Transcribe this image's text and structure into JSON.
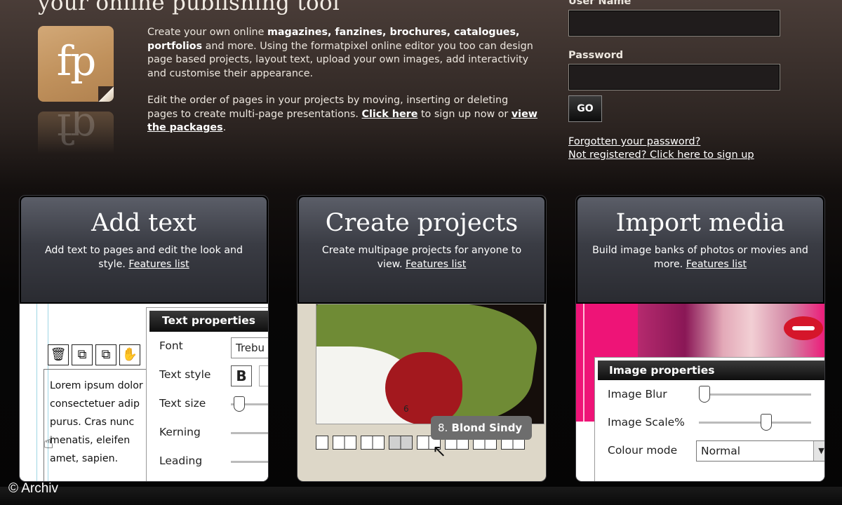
{
  "header": {
    "tagline": "your online publishing tool",
    "logo_text": "fp",
    "intro_p1_a": "Create your own online ",
    "intro_p1_bold": "magazines, fanzines, brochures, catalogues, portfolios",
    "intro_p1_b": " and more. Using the formatpixel online editor you too can design page based projects, layout text, upload your own images, add interactivity and customise their appearance.",
    "intro_p2_a": "Edit the order of pages in your projects by moving, inserting or deleting pages to create multi-page presentations. ",
    "intro_p2_link1": "Click here",
    "intro_p2_b": " to sign up now or ",
    "intro_p2_link2": "view the packages",
    "intro_p2_c": "."
  },
  "login": {
    "username_label": "User Name",
    "username_value": "",
    "password_label": "Password",
    "password_value": "",
    "go_label": "GO",
    "forgot_link": "Forgotten your password?",
    "signup_link": "Not registered? Click here to sign up"
  },
  "panels": [
    {
      "title": "Add text",
      "desc": "Add text to pages and edit the look and style.",
      "link": "Features list"
    },
    {
      "title": "Create projects",
      "desc": "Create multipage projects for anyone to view.",
      "link": "Features list"
    },
    {
      "title": "Import media",
      "desc": "Build image banks of photos or movies and more.",
      "link": "Features list"
    }
  ],
  "text_editor": {
    "card_title": "Text properties",
    "font_label": "Font",
    "font_value": "Trebu",
    "style_label": "Text style",
    "bold_label": "B",
    "size_label": "Text size",
    "kerning_label": "Kerning",
    "leading_label": "Leading",
    "lorem_lines": [
      "Lorem ipsum dolor",
      "consectetuer adip",
      "purus. Cras nunc",
      "menatis, eleifen",
      "amet, sapien."
    ],
    "text_size_level": 0.15
  },
  "projects_editor": {
    "page_number": "6",
    "tooltip_number": "8.",
    "tooltip_name": "Blond Sindy"
  },
  "media_editor": {
    "card_title": "Image properties",
    "blur_label": "Image Blur",
    "blur_level": 0.0,
    "scale_label": "Image Scale%",
    "scale_level": 0.6,
    "colour_label": "Colour mode",
    "colour_value": "Normal"
  },
  "footer": {
    "credit": "© Archiv"
  }
}
